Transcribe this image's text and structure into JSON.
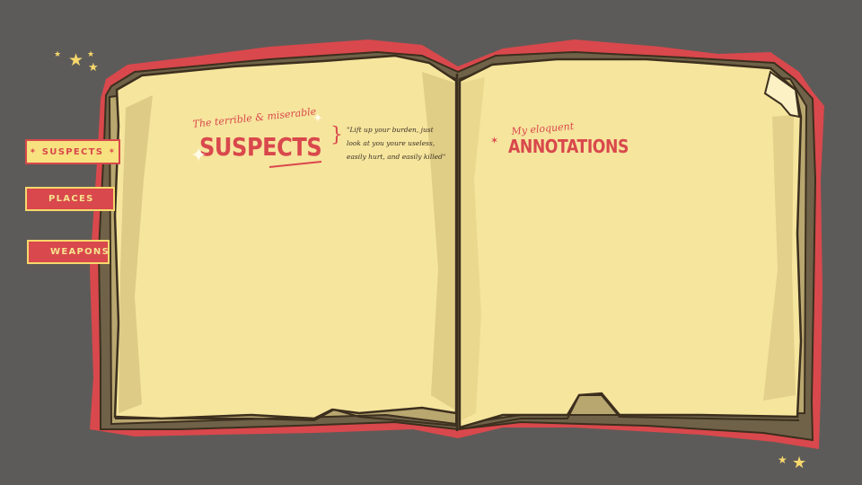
{
  "tabs": [
    {
      "label": "SUSPECTS",
      "active": true
    },
    {
      "label": "PLACES",
      "active": false
    },
    {
      "label": "WEAPONS",
      "active": false
    }
  ],
  "left_page": {
    "kicker": "The terrible & miserable",
    "heading": "SUSPECTS",
    "quote_lines": [
      "\"Lift up your burden, just",
      "look at you youre useless,",
      "easily hurt, and easily killed\""
    ]
  },
  "right_page": {
    "kicker": "My eloquent",
    "heading": "ANNOTATIONS"
  },
  "icons": {
    "tab_marker": "star-glyph",
    "brace": "curly-brace",
    "decor": [
      "sparkle-icon",
      "star-icon"
    ]
  },
  "colors": {
    "background": "#5d5b59",
    "book_border": "#d9484c",
    "page": "#f6e59d",
    "accent_red": "#d9484c",
    "tab_yellow": "#f7d86c"
  }
}
